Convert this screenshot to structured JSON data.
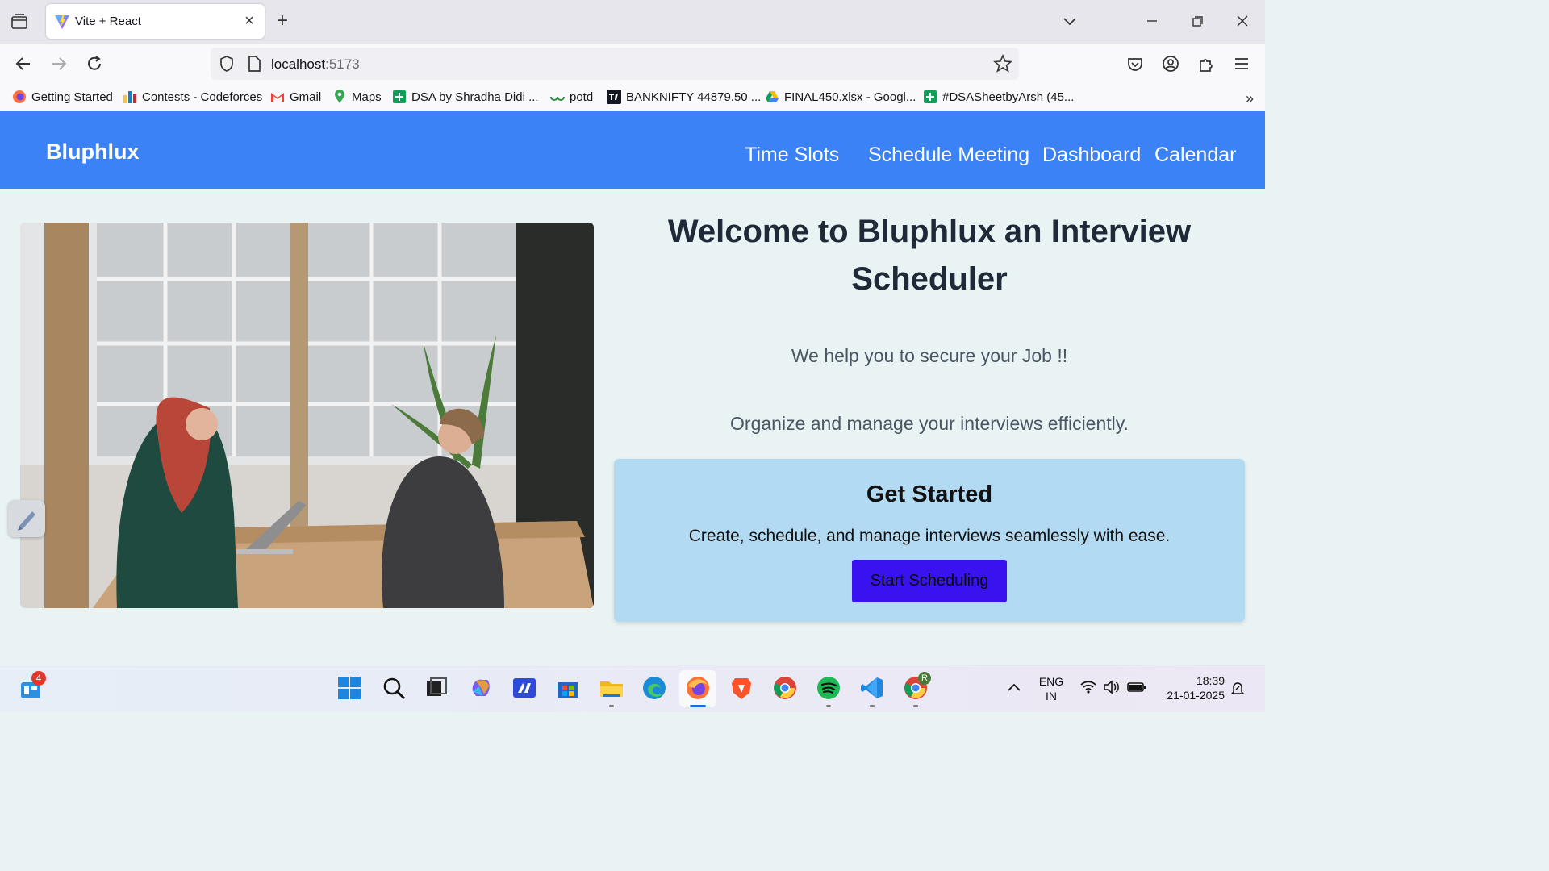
{
  "browser": {
    "tab": {
      "title": "Vite + React"
    },
    "url": {
      "host": "localhost",
      "port": ":5173"
    },
    "bookmarks": [
      "Getting Started",
      "Contests - Codeforces",
      "Gmail",
      "Maps",
      "DSA by Shradha Didi ...",
      "potd",
      "BANKNIFTY 44879.50 ...",
      "FINAL450.xlsx - Googl...",
      "#DSASheetbyArsh (45..."
    ]
  },
  "app": {
    "brand": "Bluphlux",
    "nav": [
      "Time Slots",
      "Schedule Meeting",
      "Dashboard",
      "Calendar"
    ],
    "hero": {
      "title": "Welcome to Bluphlux an Interview Scheduler",
      "tagline": "We help you to secure your Job !!",
      "subtitle": "Organize and manage your interviews efficiently."
    },
    "card": {
      "title": "Get Started",
      "description": "Create, schedule, and manage interviews seamlessly with ease.",
      "button": "Start Scheduling"
    }
  },
  "taskbar": {
    "widgets_badge": "4",
    "lang_line1": "ENG",
    "lang_line2": "IN",
    "time": "18:39",
    "date": "21-01-2025",
    "chrome_profile": "R"
  },
  "colors": {
    "header": "#3b82f6",
    "page_bg": "#e9f3f4",
    "card_bg": "#b3daf3",
    "button_bg": "#3a12f0"
  }
}
